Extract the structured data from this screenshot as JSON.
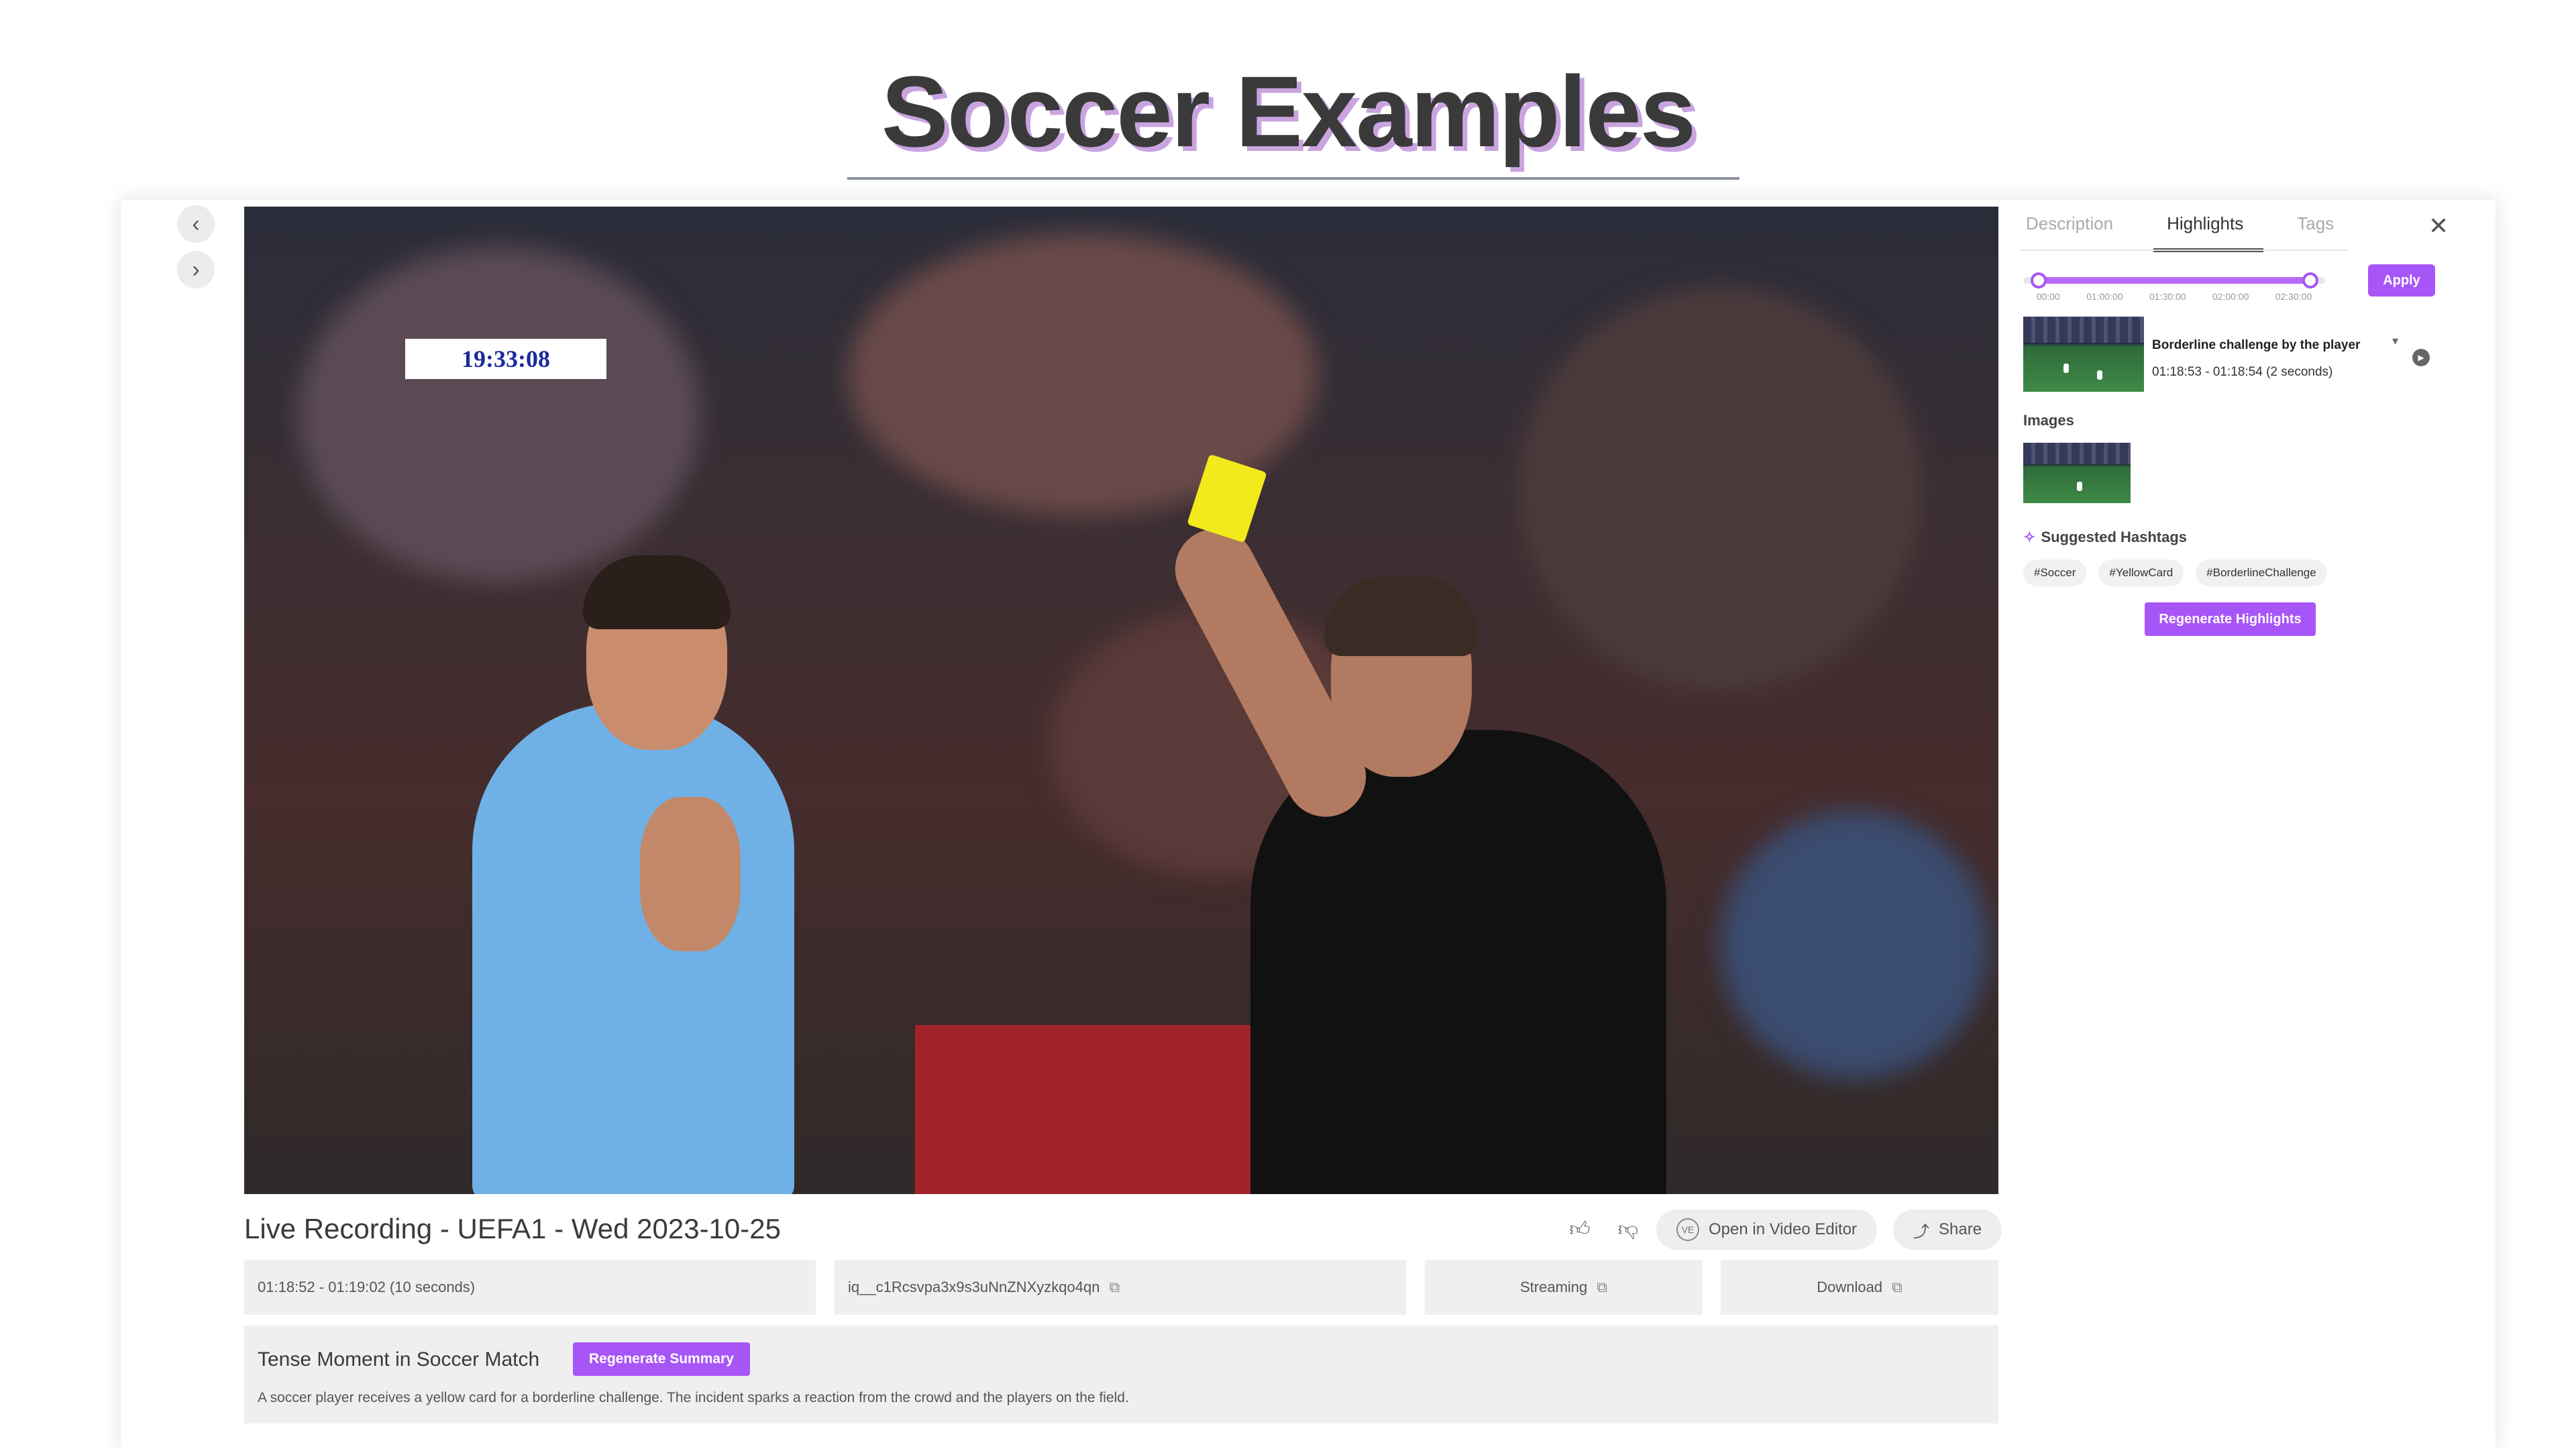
{
  "headline": "Soccer Examples",
  "player": {
    "overlay_time": "19:33:08",
    "recording_title": "Live Recording - UEFA1 - Wed 2023-10-25",
    "actions": {
      "open_editor": "Open in Video Editor",
      "open_editor_badge": "VE",
      "share": "Share"
    },
    "info": {
      "time_range": "01:18:52 - 01:19:02 (10 seconds)",
      "asset_id": "iq__c1Rcsvpa3x9s3uNnZNXyzkqo4qn",
      "streaming": "Streaming",
      "download": "Download"
    },
    "summary": {
      "title": "Tense Moment in Soccer Match",
      "regenerate": "Regenerate Summary",
      "text": "A soccer player receives a yellow card for a borderline challenge. The incident sparks a reaction from the crowd and the players on the field."
    }
  },
  "panel": {
    "tabs": [
      "Description",
      "Highlights",
      "Tags"
    ],
    "active_tab": "Highlights",
    "slider": {
      "ticks": [
        "00:00",
        "01:00:00",
        "01:30:00",
        "02:00:00",
        "02:30:00"
      ],
      "range_start_fraction": 0.05,
      "range_end_fraction": 0.95
    },
    "apply": "Apply",
    "highlight": {
      "title": "Borderline challenge by the player",
      "time": "01:18:53 - 01:18:54 (2 seconds)"
    },
    "images_label": "Images",
    "hashtags_label": "Suggested Hashtags",
    "hashtags": [
      "#Soccer",
      "#YellowCard",
      "#BorderlineChallenge"
    ],
    "regenerate": "Regenerate Highlights"
  },
  "colors": {
    "accent": "#a855f7",
    "headline_shadow": "#c9a4e0"
  }
}
